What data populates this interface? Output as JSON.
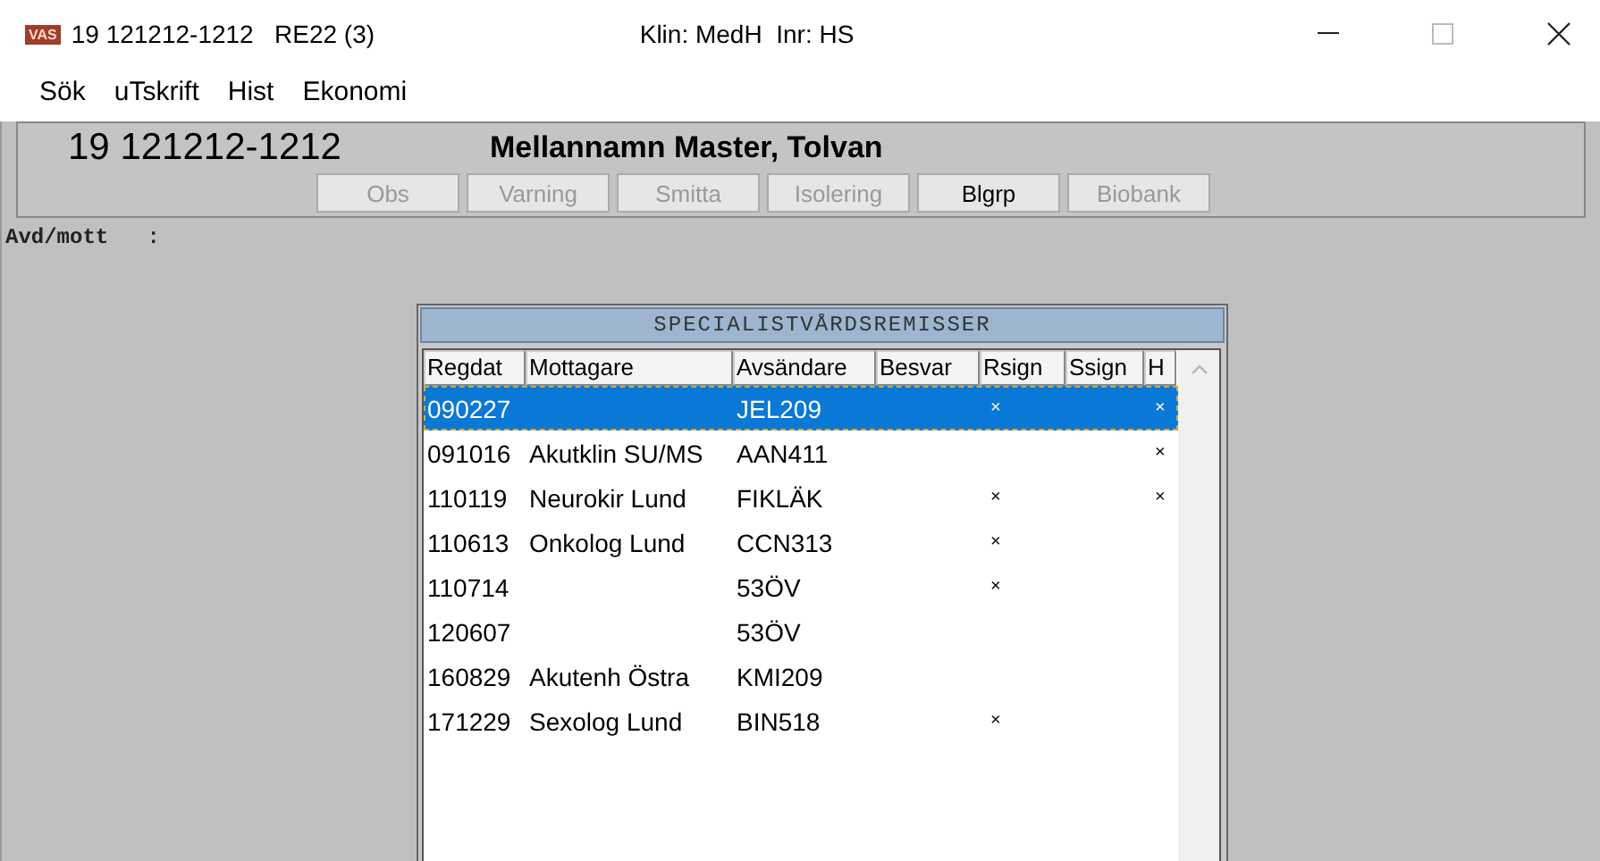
{
  "window": {
    "logo": "VAS",
    "title": "19 121212-1212   RE22 (3)",
    "clinic": "Klin: MedH  Inr: HS"
  },
  "menu": [
    "Sök",
    "uTskrift",
    "Hist",
    "Ekonomi"
  ],
  "patient": {
    "id": "19 121212-1212",
    "name": "Mellannamn Master, Tolvan"
  },
  "buttons": [
    {
      "label": "Obs",
      "disabled": true
    },
    {
      "label": "Varning",
      "disabled": true
    },
    {
      "label": "Smitta",
      "disabled": true
    },
    {
      "label": "Isolering",
      "disabled": true
    },
    {
      "label": "Blgrp",
      "disabled": false
    },
    {
      "label": "Biobank",
      "disabled": true
    }
  ],
  "field_label": "Avd/mott   :",
  "dialog": {
    "title": "SPECIALISTVÅRDSREMISSER",
    "columns": [
      "Regdat",
      "Mottagare",
      "Avsändare",
      "Besvar",
      "Rsign",
      "Ssign",
      "H"
    ],
    "rows": [
      {
        "regdat": "090227",
        "avsandare": "JEL209",
        "rsign": "×",
        "h": "×",
        "selected": true
      },
      {
        "regdat": "091016",
        "mottagare": "Akutklin SU/MS",
        "avsandare": "AAN411",
        "h": "×",
        "selected": false
      },
      {
        "regdat": "110119",
        "mottagare": "Neurokir Lund",
        "avsandare": "FIKLÄK",
        "rsign": "×",
        "h": "×",
        "selected": false
      },
      {
        "regdat": "110613",
        "mottagare": "Onkolog Lund",
        "avsandare": "CCN313",
        "rsign": "×",
        "selected": false
      },
      {
        "regdat": "110714",
        "avsandare": "53ÖV",
        "rsign": "×",
        "selected": false
      },
      {
        "regdat": "120607",
        "avsandare": "53ÖV",
        "selected": false
      },
      {
        "regdat": "160829",
        "mottagare": "Akutenh Östra",
        "avsandare": "KMI209",
        "selected": false
      },
      {
        "regdat": "171229",
        "mottagare": "Sexolog Lund",
        "avsandare": "BIN518",
        "rsign": "×",
        "selected": false
      }
    ]
  }
}
